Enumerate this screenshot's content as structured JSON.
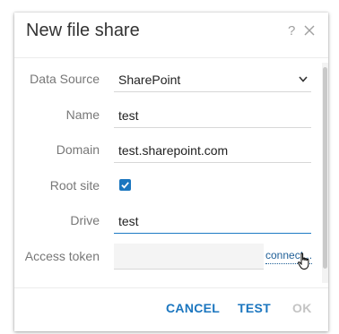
{
  "dialog": {
    "title": "New file share",
    "help_symbol": "?"
  },
  "form": {
    "data_source": {
      "label": "Data Source",
      "value": "SharePoint"
    },
    "name": {
      "label": "Name",
      "value": "test"
    },
    "domain": {
      "label": "Domain",
      "value": "test.sharepoint.com"
    },
    "root_site": {
      "label": "Root site",
      "checked": true
    },
    "drive": {
      "label": "Drive",
      "value": "test"
    },
    "access_token": {
      "label": "Access token",
      "value": "",
      "action_label": "connect..."
    }
  },
  "footer": {
    "cancel_label": "CANCEL",
    "test_label": "TEST",
    "ok_label": "OK"
  },
  "colors": {
    "accent": "#1b76bf",
    "disabled": "#c4c4c4",
    "label": "#777777"
  }
}
